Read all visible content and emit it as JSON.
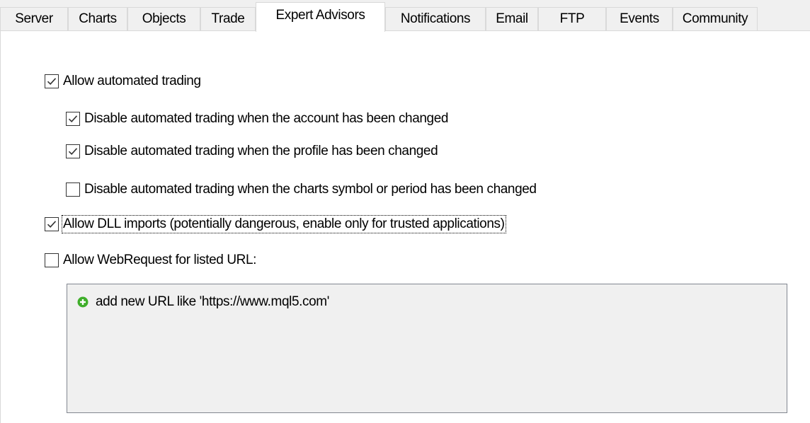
{
  "tabs": [
    {
      "label": "Server"
    },
    {
      "label": "Charts"
    },
    {
      "label": "Objects"
    },
    {
      "label": "Trade"
    },
    {
      "label": "Expert Advisors",
      "active": true
    },
    {
      "label": "Notifications"
    },
    {
      "label": "Email"
    },
    {
      "label": "FTP"
    },
    {
      "label": "Events"
    },
    {
      "label": "Community"
    }
  ],
  "options": {
    "allow_automated_trading": {
      "label": "Allow automated trading",
      "checked": true
    },
    "disable_on_account_change": {
      "label": "Disable automated trading when the account has been changed",
      "checked": true
    },
    "disable_on_profile_change": {
      "label": "Disable automated trading when the profile has been changed",
      "checked": true
    },
    "disable_on_symbol_change": {
      "label": "Disable automated trading when the charts symbol or period has been changed",
      "checked": false
    },
    "allow_dll_imports": {
      "label": "Allow DLL imports (potentially dangerous, enable only for trusted applications)",
      "checked": true
    },
    "allow_webrequest": {
      "label": "Allow WebRequest for listed URL:",
      "checked": false
    }
  },
  "url_list": {
    "add_label": "add new URL like 'https://www.mql5.com'",
    "add_icon": "plus-circle-icon"
  },
  "colors": {
    "check": "#333333",
    "add_icon": "#3fae2a",
    "panel_bg": "#ffffff",
    "window_bg": "#f0f0f0",
    "list_bg": "#f0f0f0",
    "border": "#d9d9d9"
  }
}
